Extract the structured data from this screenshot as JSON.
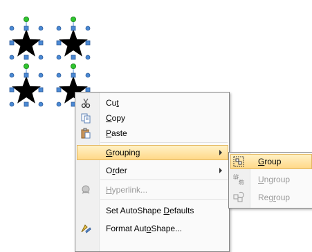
{
  "colors": {
    "shape_fill": "#000000",
    "handle_fill": "#4a89d4",
    "rotate_handle": "#2fc72f",
    "highlight": "#ffd785",
    "disabled_text": "#9a9a9a"
  },
  "menu": {
    "items": [
      {
        "label_pre": "Cu",
        "label_key": "t",
        "label_post": "",
        "icon": "scissors-icon"
      },
      {
        "label_pre": "",
        "label_key": "C",
        "label_post": "opy",
        "icon": "copy-icon"
      },
      {
        "label_pre": "",
        "label_key": "P",
        "label_post": "aste",
        "icon": "paste-icon"
      },
      {
        "label_pre": "",
        "label_key": "G",
        "label_post": "rouping",
        "icon": "",
        "submenu": true,
        "highlighted": true
      },
      {
        "label_pre": "O",
        "label_key": "r",
        "label_post": "der",
        "icon": "",
        "submenu": true
      },
      {
        "label_pre": "",
        "label_key": "H",
        "label_post": "yperlink...",
        "icon": "hyperlink-icon",
        "disabled": true
      },
      {
        "label_pre": "Set AutoShape ",
        "label_key": "D",
        "label_post": "efaults",
        "icon": ""
      },
      {
        "label_pre": "Format Aut",
        "label_key": "o",
        "label_post": "Shape...",
        "icon": "format-shape-icon"
      }
    ]
  },
  "submenu": {
    "items": [
      {
        "label_pre": "",
        "label_key": "G",
        "label_post": "roup",
        "icon": "group-icon",
        "highlighted": true
      },
      {
        "label_pre": "",
        "label_key": "U",
        "label_post": "ngroup",
        "icon": "ungroup-icon",
        "disabled": true
      },
      {
        "label_pre": "Reg",
        "label_key": "r",
        "label_post": "oup",
        "icon": "regroup-icon",
        "disabled": true
      }
    ]
  }
}
